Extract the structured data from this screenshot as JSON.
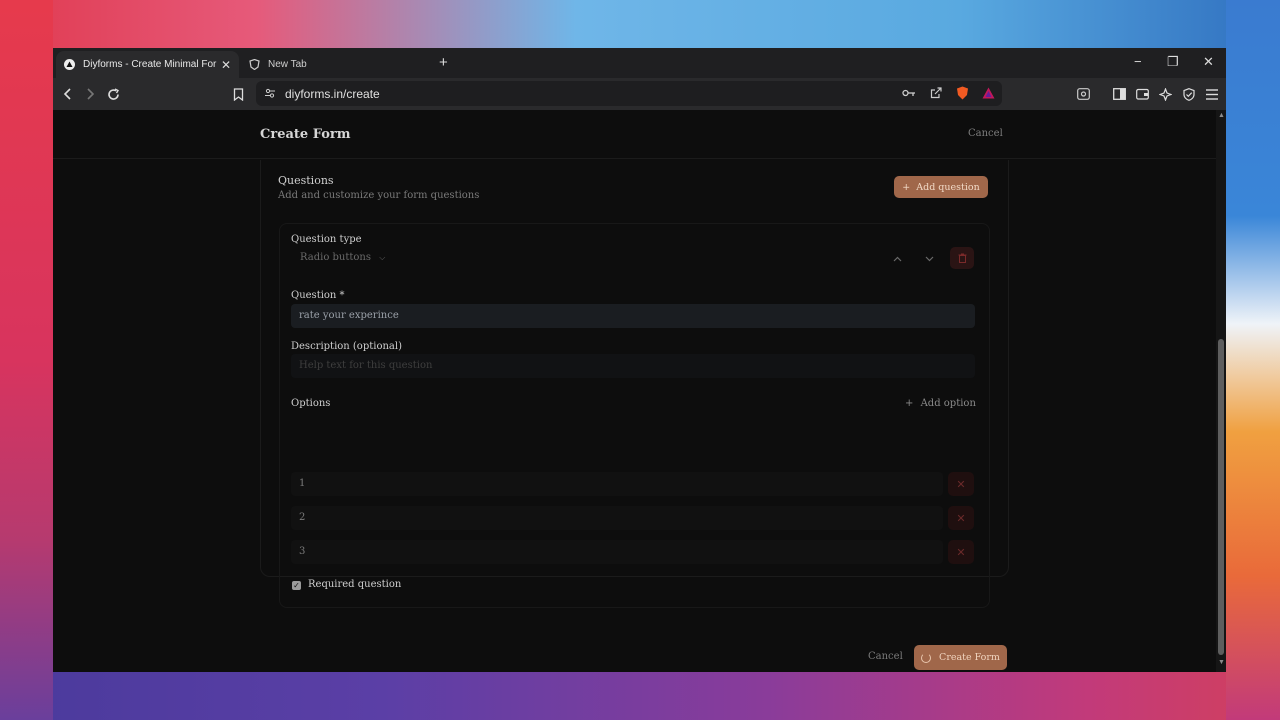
{
  "browser": {
    "tabs": [
      {
        "label": "Diyforms - Create Minimal Forms",
        "active": true
      },
      {
        "label": "New Tab",
        "active": false
      }
    ],
    "new_tab": "+",
    "url": "diyforms.in/create",
    "window_controls": {
      "minimize": "−",
      "restore": "❐",
      "close": "✕"
    }
  },
  "page": {
    "title": "Create Form",
    "header_cancel": "Cancel",
    "questions": {
      "title": "Questions",
      "subtitle": "Add and customize your form questions",
      "add_button": "Add question"
    },
    "question": {
      "type_label": "Question type",
      "type_value": "Radio buttons",
      "question_label": "Question *",
      "question_value": "rate your experince",
      "description_label": "Description (optional)",
      "description_placeholder": "Help text for this question",
      "options_label": "Options",
      "add_option": "Add option",
      "options": [
        "1",
        "2",
        "3"
      ],
      "required_label": "Required question",
      "required_checked": true
    },
    "footer": {
      "cancel": "Cancel",
      "create": "Create Form"
    }
  },
  "colors": {
    "accent": "#a0674a",
    "background": "#0d0d0d"
  }
}
